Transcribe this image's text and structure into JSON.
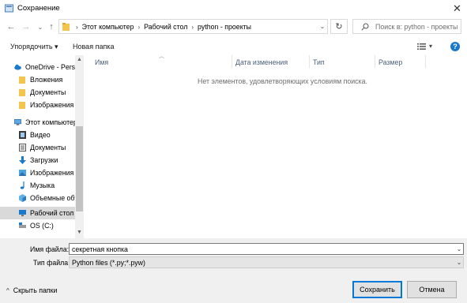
{
  "window": {
    "title": "Сохранение",
    "close_glyph": "✕"
  },
  "nav": {
    "back": "←",
    "forward": "→",
    "recent_dropdown": "⌄",
    "up": "↑",
    "address_segments": [
      "Этот компьютер",
      "Рабочий стол",
      "python - проекты"
    ],
    "address_separator": "›",
    "address_dropdown": "⌄",
    "refresh": "↻",
    "search_placeholder": "Поиск в: python - проекты"
  },
  "toolbar": {
    "organize": "Упорядочить ▾",
    "new_folder": "Новая папка",
    "view_menu": "▾",
    "help": "?"
  },
  "sidebar": {
    "items": [
      {
        "label": "OneDrive - Person",
        "icon": "onedrive-cloud-icon",
        "level": 0
      },
      {
        "label": "Вложения",
        "icon": "folder-icon",
        "level": 1
      },
      {
        "label": "Документы",
        "icon": "folder-icon",
        "level": 1
      },
      {
        "label": "Изображения",
        "icon": "folder-icon",
        "level": 1
      },
      {
        "label": "Этот компьютер",
        "icon": "computer-icon",
        "level": 0
      },
      {
        "label": "Видео",
        "icon": "video-icon",
        "level": 1
      },
      {
        "label": "Документы",
        "icon": "documents-icon",
        "level": 1
      },
      {
        "label": "Загрузки",
        "icon": "downloads-icon",
        "level": 1
      },
      {
        "label": "Изображения",
        "icon": "pictures-icon",
        "level": 1
      },
      {
        "label": "Музыка",
        "icon": "music-icon",
        "level": 1
      },
      {
        "label": "Объемные объ",
        "icon": "3d-objects-icon",
        "level": 1
      },
      {
        "label": "Рабочий стол",
        "icon": "desktop-icon",
        "level": 1,
        "selected": true
      },
      {
        "label": "OS (C:)",
        "icon": "drive-icon",
        "level": 1
      }
    ]
  },
  "content": {
    "columns": [
      "Имя",
      "Дата изменения",
      "Тип",
      "Размер"
    ],
    "empty_message": "Нет элементов, удовлетворяющих условиям поиска."
  },
  "bottom": {
    "filename_label": "Имя файла:",
    "filename_value": "секретная кнопка",
    "filetype_label": "Тип файла:",
    "filetype_value": "Python files (*.py;*.pyw)",
    "hide_folders": "Скрыть папки",
    "save": "Сохранить",
    "cancel": "Отмена"
  },
  "colors": {
    "accent": "#0078d7",
    "folder": "#f4c44c",
    "selected_bg": "#d9d9d9",
    "bottom_bg": "#f0f0f0"
  }
}
